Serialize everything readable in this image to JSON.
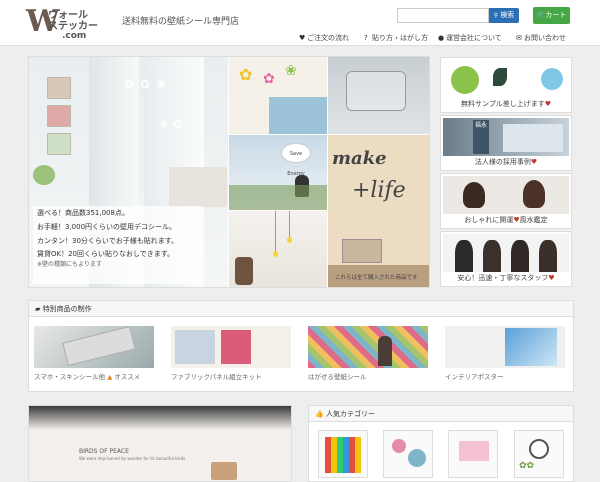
{
  "header": {
    "logo_w": "W",
    "logo_line1": "ウォール",
    "logo_line2": "ステッカー",
    "logo_line3": ".com",
    "tagline": "送料無料の壁紙シール専門店",
    "search_placeholder": "",
    "search_button": "検索",
    "cart_button": "カート"
  },
  "nav": [
    {
      "icon": "heart-icon",
      "glyph": "♥",
      "label": "ご注文の流れ"
    },
    {
      "icon": "question-icon",
      "glyph": "?",
      "label": "貼り方・はがし方"
    },
    {
      "icon": "user-icon",
      "glyph": "●",
      "label": "運営会社について"
    },
    {
      "icon": "mail-icon",
      "glyph": "✉",
      "label": "お問い合わせ"
    }
  ],
  "hero": {
    "line1": "選べる！商品数351,008点。",
    "line2": "お手軽！3,000円くらいの壁用デコシール。",
    "line3": "カンタン！30分くらいでお子様も貼れます。",
    "line4": "賃貸OK！20回くらい貼りなおしできます。",
    "line5": "※壁の種類にもよります",
    "caption": "これらは全て購入された商品です",
    "wall_text1": "make",
    "wall_text2": "+life"
  },
  "side_cards": [
    {
      "label": "無料サンプル差し上げます",
      "heart": "♥"
    },
    {
      "label": "法人様の採用事例",
      "heart": "♥"
    },
    {
      "label": "おしゃれに開運",
      "heart": "♥",
      "suffix": "風水鑑定"
    },
    {
      "label": "安心！迅速・丁寧なスタッフ",
      "heart": "♥"
    }
  ],
  "special": {
    "title": "特別商品の制作",
    "items": [
      {
        "label": "スマホ・スキンシール他",
        "suffix": "オススメ"
      },
      {
        "label": "ファブリックパネル組立キット"
      },
      {
        "label": "はがせる壁紙シール"
      },
      {
        "label": "インテリアポスター"
      }
    ]
  },
  "banner": {
    "title": "BIRDS OF PEACE",
    "sub": "We were imprisoned by wonder for its beautiful birds"
  },
  "popular": {
    "title": "人気カテゴリー"
  },
  "colors": {
    "accent_blue": "#2a6fb5",
    "cart_green": "#45a845",
    "heart_red": "#c0392b"
  }
}
